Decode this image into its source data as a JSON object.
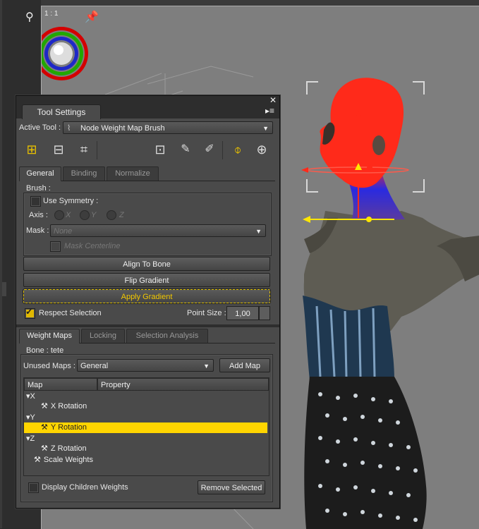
{
  "viewport": {
    "ratio_label": "1 : 1",
    "icons": [
      "figure-icon",
      "pin-icon",
      "camera-orbit-widget-icon"
    ],
    "colors": {
      "background": "#7e7e7e",
      "head_red": "#ff2a1a",
      "gizmo_yellow": "#ffe600"
    }
  },
  "panel": {
    "title": "Tool Settings",
    "close_glyph": "✕",
    "menu_glyph": "▸≡",
    "active_tool_label": "Active Tool :",
    "active_tool_value": "Node Weight Map Brush",
    "tool_icons": [
      "node-select-icon",
      "transfer-icon",
      "region-select-icon",
      "weight-paint-icon",
      "paint-brush-p-icon",
      "smooth-brush-s-icon",
      "joint-icon",
      "sphere-icon"
    ],
    "tabs": [
      "General",
      "Binding",
      "Normalize"
    ],
    "brush": {
      "group_label": "Brush :",
      "use_symmetry_label": "Use Symmetry :",
      "axis_label": "Axis :",
      "axis_options": [
        "X",
        "Y",
        "Z"
      ],
      "mask_label": "Mask :",
      "mask_value": "None",
      "mask_centerline_label": "Mask Centerline"
    },
    "buttons": {
      "align_to_bone": "Align To Bone",
      "flip_gradient": "Flip Gradient",
      "apply_gradient": "Apply Gradient"
    },
    "respect_selection_label": "Respect Selection",
    "point_size_label": "Point Size :",
    "point_size_value": "1,00",
    "lower_tabs": [
      "Weight Maps",
      "Locking",
      "Selection Analysis"
    ],
    "bone_label": "Bone : tete",
    "unused_maps_label": "Unused Maps :",
    "unused_maps_value": "General",
    "add_map_label": "Add Map",
    "columns": [
      "Map",
      "Property"
    ],
    "tree": [
      {
        "label": "X",
        "level": 0
      },
      {
        "label": "X Rotation",
        "level": 1
      },
      {
        "label": "Y",
        "level": 0
      },
      {
        "label": "Y Rotation",
        "level": 1,
        "selected": true
      },
      {
        "label": "Z",
        "level": 0
      },
      {
        "label": "Z Rotation",
        "level": 1
      },
      {
        "label": "Scale Weights",
        "level": 0
      }
    ],
    "display_children_label": "Display Children Weights",
    "remove_selected_label": "Remove Selected"
  }
}
